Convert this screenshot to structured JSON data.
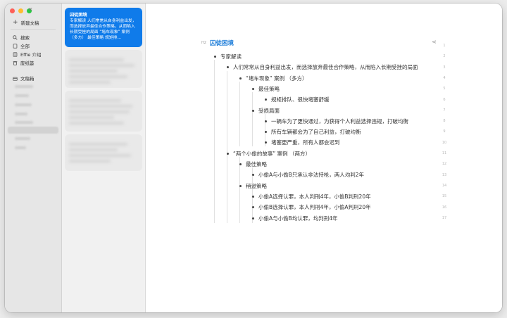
{
  "sidebar": {
    "new_doc": "新建文稿",
    "items": [
      {
        "label": "搜索",
        "icon": "search-icon"
      },
      {
        "label": "全部",
        "icon": "document-icon"
      },
      {
        "label": "Effie 介绍",
        "icon": "file-icon"
      },
      {
        "label": "废纸篓",
        "icon": "trash-icon"
      }
    ],
    "doc_box": "文稿箱"
  },
  "notes_list": {
    "active": {
      "title": "囚徒困境",
      "preview": "专家解读 人们常常从自身利益出发，而选择放弃最佳合作策略，从而陷入长期受挫的局面 “堵车现象” 案例 （多方） 最佳策略 规矩排..."
    }
  },
  "editor": {
    "heading_tag": "H2",
    "title": "囚徒困境",
    "outline": [
      {
        "text": "专家解读",
        "level": 1
      },
      {
        "text": "人们常常从自身利益出发，而选择放弃最佳合作策略，从而陷入长期受挫的局面",
        "level": 2
      },
      {
        "text": "“堵车现象” 案例 （多方）",
        "level": 3
      },
      {
        "text": "最佳策略",
        "level": 4
      },
      {
        "text": "规矩排队、很快堵塞舒缓",
        "level": 5
      },
      {
        "text": "受损局面",
        "level": 4
      },
      {
        "text": "一辆车为了更快通过，为获得个人利益选择违规，打破均衡",
        "level": 5
      },
      {
        "text": "所有车辆都会为了自己利益，打破均衡",
        "level": 5
      },
      {
        "text": "堵塞更严重，所有人都会迟到",
        "level": 5
      },
      {
        "text": "“两个小偷的故事” 案例 （两方）",
        "level": 2
      },
      {
        "text": "最佳策略",
        "level": 3
      },
      {
        "text": "小偷A与小偷B只承认非法持枪，两人均判2年",
        "level": 4
      },
      {
        "text": "稍逊策略",
        "level": 3
      },
      {
        "text": "小偷A选择认罪，本人判刑4年，小偷B判刑20年",
        "level": 4
      },
      {
        "text": "小偷B选择认罪，本人判刑4年，小偷A判刑20年",
        "level": 4
      },
      {
        "text": "小偷A与小偷B均认罪，均判刑4年",
        "level": 4
      }
    ],
    "line_numbers": [
      "1",
      "2",
      "3",
      "4",
      "5",
      "6",
      "7",
      "8",
      "9",
      "10",
      "11",
      "12",
      "13",
      "14",
      "15",
      "16",
      "17"
    ]
  }
}
